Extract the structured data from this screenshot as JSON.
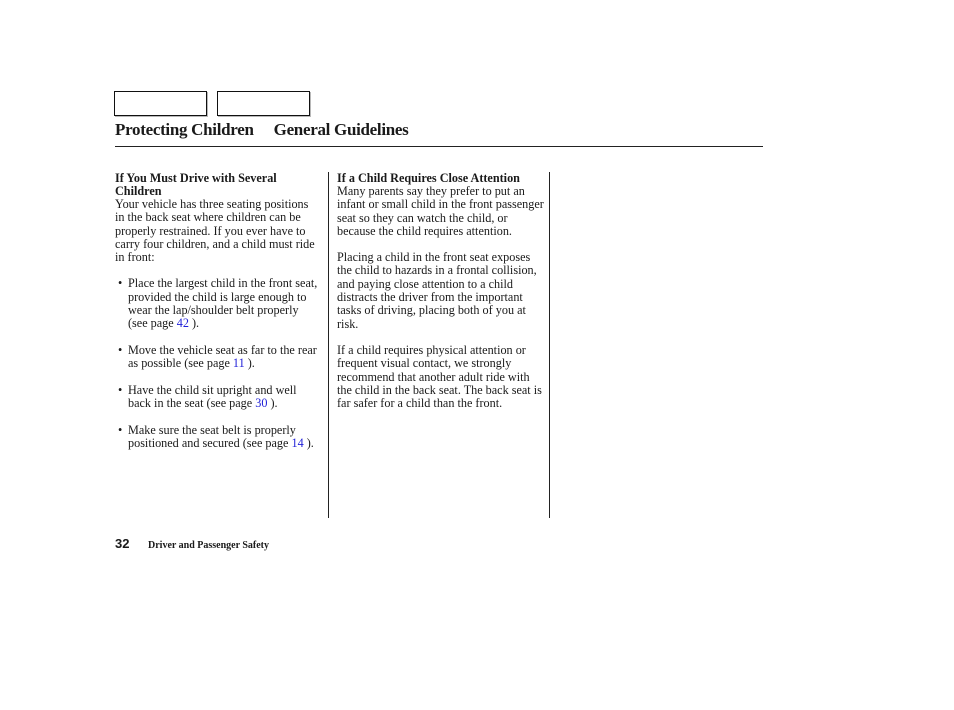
{
  "nav": {
    "boxes": [
      {
        "label": ""
      },
      {
        "label": ""
      }
    ]
  },
  "header": {
    "chapter": "Protecting Children",
    "section": "General Guidelines"
  },
  "columns": [
    {
      "heading": "If You Must Drive with Several Children",
      "intro": "Your vehicle has three seating positions in the back seat where children can be properly restrained. If you ever have to carry four children, and a child must ride in front:",
      "bullets": [
        {
          "text": "Place the largest child in the front seat, provided the child is large enough to wear the lap/shoulder belt properly (see page ",
          "link": "42",
          "after": " )."
        },
        {
          "text": "Move the vehicle seat as far to the rear as possible (see page ",
          "link": "11",
          "after": " )."
        },
        {
          "text": "Have the child sit upright and well back in the seat (see page ",
          "link": "30",
          "after": " )."
        },
        {
          "text": "Make sure the seat belt is properly positioned and secured (see page ",
          "link": "14",
          "after": " )."
        }
      ],
      "bullet_glyph": "•"
    },
    {
      "heading": "If a Child Requires Close Attention",
      "paragraphs": [
        "Many parents say they prefer to put an infant or small child in the front passenger seat so they can watch the child, or because the child requires attention.",
        "Placing a child in the front seat exposes the child to hazards in a frontal collision, and paying close attention to a child distracts the driver from the important tasks of driving, placing both of you at risk.",
        "If a child requires physical attention or frequent visual contact, we strongly recommend that another adult ride with the child in the back seat. The back seat is far safer for a child than the front."
      ]
    }
  ],
  "footer": {
    "page_number": "32",
    "chapter_title": "Driver and Passenger Safety"
  },
  "colors": {
    "link": "#1f1fd8",
    "text": "#1a1a1a",
    "rule": "#222222"
  }
}
